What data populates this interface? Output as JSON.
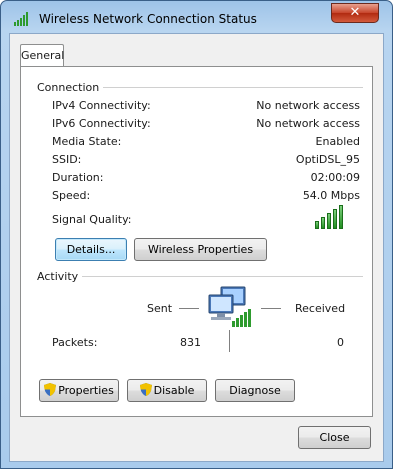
{
  "window": {
    "title": "Wireless Network Connection Status",
    "close_glyph": "✕"
  },
  "tabs": [
    {
      "label": "General"
    }
  ],
  "connection": {
    "group_label": "Connection",
    "rows": [
      {
        "label": "IPv4 Connectivity:",
        "value": "No network access"
      },
      {
        "label": "IPv6 Connectivity:",
        "value": "No network access"
      },
      {
        "label": "Media State:",
        "value": "Enabled"
      },
      {
        "label": "SSID:",
        "value": "OptiDSL_95"
      },
      {
        "label": "Duration:",
        "value": "02:00:09"
      },
      {
        "label": "Speed:",
        "value": "54.0 Mbps"
      }
    ],
    "signal_label": "Signal Quality:",
    "signal_bars_filled": 5,
    "signal_bars_total": 5,
    "details_button": "Details...",
    "wireless_properties_button": "Wireless Properties"
  },
  "activity": {
    "group_label": "Activity",
    "sent_label": "Sent",
    "received_label": "Received",
    "packets_label": "Packets:",
    "packets_sent": "831",
    "packets_received": "0"
  },
  "actions": {
    "properties": "Properties",
    "disable": "Disable",
    "diagnose": "Diagnose"
  },
  "footer": {
    "close": "Close"
  },
  "colors": {
    "signal_green": "#2e9b2e",
    "focus_blue": "#3c7fb1"
  }
}
